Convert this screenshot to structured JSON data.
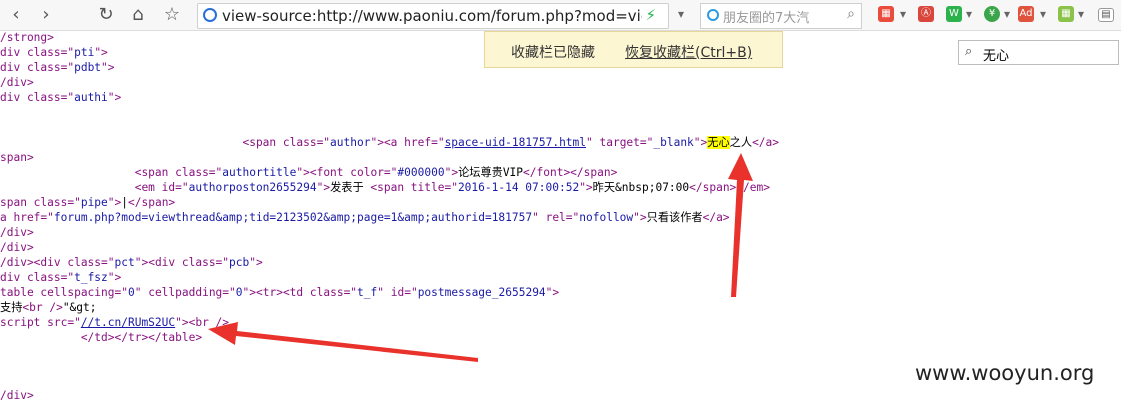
{
  "toolbar": {
    "back": "‹",
    "forward": "›",
    "reload": "↻",
    "home": "⌂",
    "star": "☆",
    "url": "view-source:http://www.paoniu.com/forum.php?mod=vie",
    "search_placeholder": "朋友圈的7大汽",
    "ext1": "Ⓐ",
    "ext2": "W",
    "ext3": "¥",
    "ext4": "Ad"
  },
  "notice": {
    "hidden_text": "收藏栏已隐藏",
    "restore_link": "恢复收藏栏(Ctrl+B)"
  },
  "find": {
    "value": "无心"
  },
  "source": {
    "l1": "/strong>",
    "l2a": "div class=\"",
    "l2b": "pti",
    "l2c": "\">",
    "l3a": "div class=\"",
    "l3b": "pdbt",
    "l3c": "\">",
    "l4": "/div>",
    "l5a": "div class=\"",
    "l5b": "authi",
    "l5c": "\">",
    "l6a": "                                    <span class=\"",
    "l6b": "author",
    "l6c": "\"><a href=\"",
    "l6d": "space-uid-181757.html",
    "l6e": "\" target=\"",
    "l6f": "_blank",
    "l6g": "\">",
    "l6h": "无心",
    "l6i": "之人",
    "l6j": "</a>",
    "l7": "span>",
    "l8a": "                    <span class=\"",
    "l8b": "authortitle",
    "l8c": "\"><font color=\"",
    "l8d": "#000000",
    "l8e": "\">",
    "l8f": "论坛尊贵VIP",
    "l8g": "</font></span>",
    "l9a": "                    <em id=\"",
    "l9b": "authorposton2655294",
    "l9c": "\">",
    "l9d": "发表于 ",
    "l9e": "<span title=\"",
    "l9f": "2016-1-14 07:00:52",
    "l9g": "\">",
    "l9h": "昨天&nbsp;07:00",
    "l9i": "</span></em>",
    "l10a": "span class=\"",
    "l10b": "pipe",
    "l10c": "\">",
    "l10d": "|",
    "l10e": "</span>",
    "l11a": "a href=\"",
    "l11b": "forum.php?mod=viewthread&amp;tid=2123502&amp;page=1&amp;authorid=181757",
    "l11c": "\" rel=\"",
    "l11d": "nofollow",
    "l11e": "\">",
    "l11f": "只看该作者",
    "l11g": "</a>",
    "l12": "/div>",
    "l13": "/div>",
    "l14a": "/div><div class=\"",
    "l14b": "pct",
    "l14c": "\"><div class=\"",
    "l14d": "pcb",
    "l14e": "\">",
    "l15a": "div class=\"",
    "l15b": "t_fsz",
    "l15c": "\">",
    "l16a": "table cellspacing=\"",
    "l16b": "0",
    "l16c": "\" cellpadding=\"",
    "l16d": "0",
    "l16e": "\"><tr><td class=\"",
    "l16f": "t_f",
    "l16g": "\" id=\"",
    "l16h": "postmessage_2655294",
    "l16i": "\">",
    "l17a": "支持",
    "l17b": "<br />",
    "l17c": "\"&gt;",
    "l18a": "script src=\"",
    "l18b": "//t.cn/RUmS2UC",
    "l18c": "\"><br />",
    "l19": "            </td></tr></table>",
    "l20": "/div>"
  },
  "watermark": "www.wooyun.org",
  "colors": {
    "tag": "#881280",
    "attribute_value": "#1a1aa6",
    "highlight": "#ffff00",
    "arrow": "#e8322b"
  }
}
